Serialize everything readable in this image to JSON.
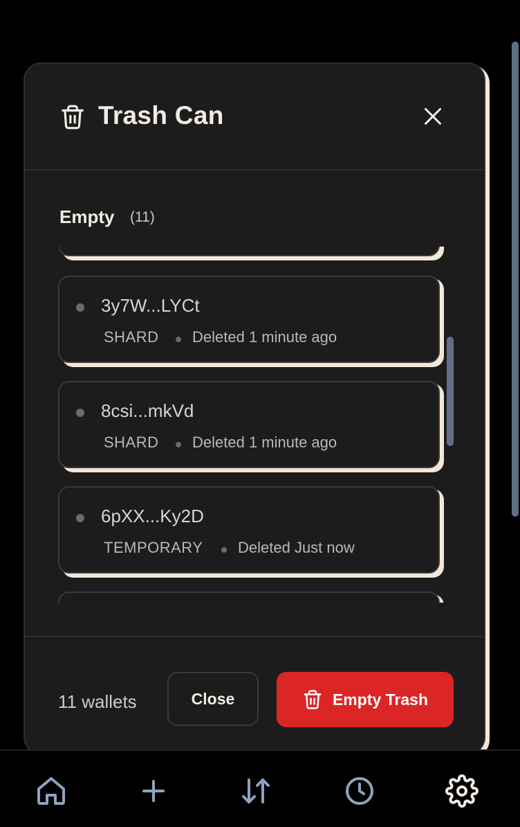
{
  "modal": {
    "title": "Trash Can",
    "icon": "trash-icon",
    "close_icon": "close-icon"
  },
  "section": {
    "heading": "Empty",
    "count": "(11)"
  },
  "items": [
    {
      "address": "3y7W...LYCt",
      "type": "SHARD",
      "deleted": "Deleted 1 minute ago"
    },
    {
      "address": "8csi...mkVd",
      "type": "SHARD",
      "deleted": "Deleted 1 minute ago"
    },
    {
      "address": "6pXX...Ky2D",
      "type": "TEMPORARY",
      "deleted": "Deleted Just now"
    }
  ],
  "footer": {
    "wallet_count": "11 wallets",
    "close_label": "Close",
    "empty_trash_label": "Empty Trash"
  },
  "nav": [
    {
      "icon": "home-icon"
    },
    {
      "icon": "plus-icon"
    },
    {
      "icon": "transfer-arrows-icon"
    },
    {
      "icon": "clock-icon"
    },
    {
      "icon": "gear-icon"
    }
  ],
  "colors": {
    "background": "#000000",
    "modal_bg": "#1c1c1c",
    "accent_shadow": "#f3e7da",
    "danger": "#dc2626",
    "nav_icon": "#8fa3bf",
    "nav_icon_active": "#f2ece4"
  }
}
